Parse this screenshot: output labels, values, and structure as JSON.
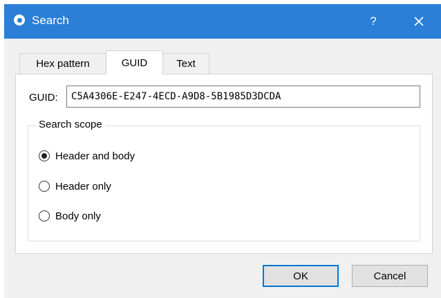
{
  "window": {
    "title": "Search",
    "help_label": "?",
    "accent_color": "#2b7fd6"
  },
  "tabs": [
    {
      "label": "Hex pattern",
      "active": false
    },
    {
      "label": "GUID",
      "active": true
    },
    {
      "label": "Text",
      "active": false
    }
  ],
  "guid": {
    "label": "GUID:",
    "value": "C5A4306E-E247-4ECD-A9D8-5B1985D3DCDA"
  },
  "scope": {
    "legend": "Search scope",
    "options": [
      {
        "label": "Header and body",
        "selected": true
      },
      {
        "label": "Header only",
        "selected": false
      },
      {
        "label": "Body only",
        "selected": false
      }
    ]
  },
  "buttons": {
    "ok_label": "OK",
    "cancel_label": "Cancel"
  }
}
